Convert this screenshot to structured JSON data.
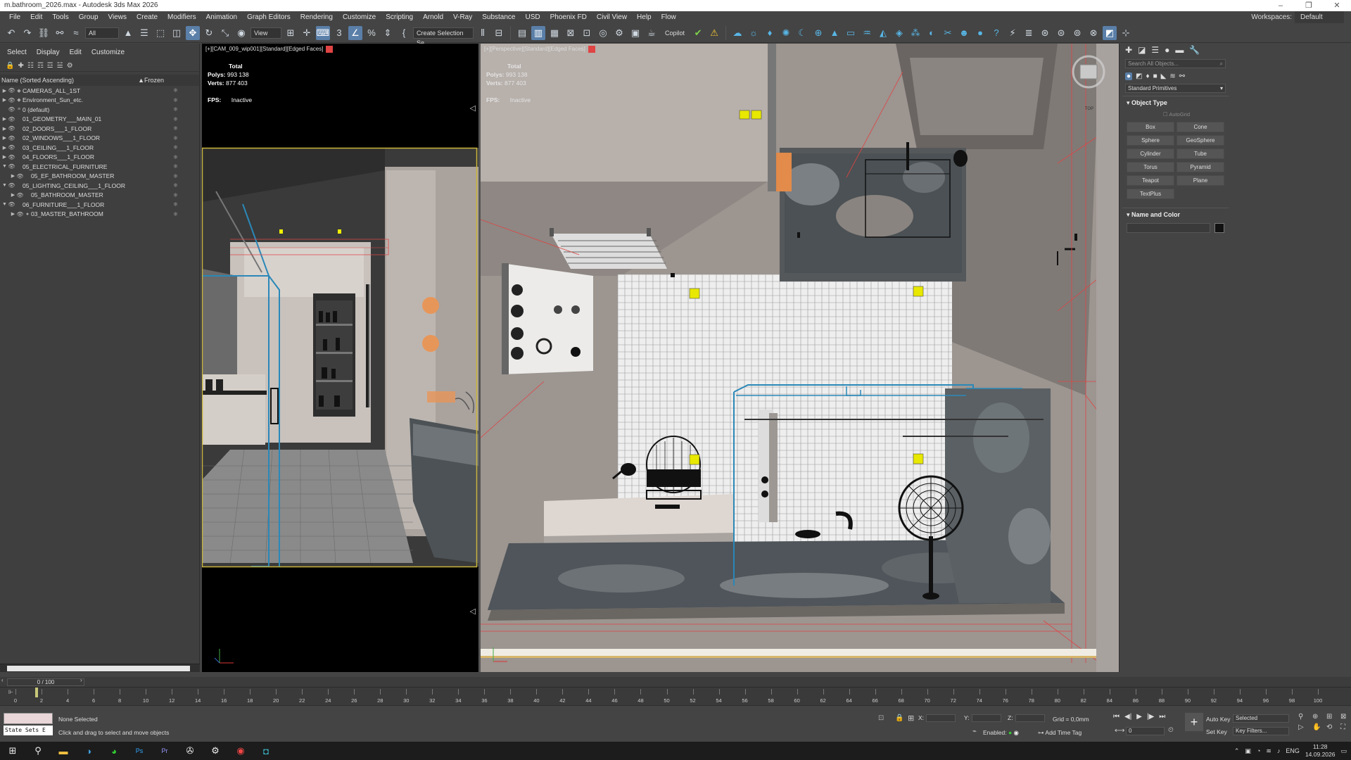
{
  "window": {
    "title": "m.bathroom_2026.max - Autodesk 3ds Max 2026"
  },
  "menu": [
    "File",
    "Edit",
    "Tools",
    "Group",
    "Views",
    "Create",
    "Modifiers",
    "Animation",
    "Graph Editors",
    "Rendering",
    "Customize",
    "Scripting",
    "Arnold",
    "V-Ray",
    "Substance",
    "USD",
    "Phoenix FD",
    "Civil View",
    "Help",
    "Flow"
  ],
  "workspaces": {
    "label": "Workspaces:",
    "value": "Default"
  },
  "toolbar": {
    "filter": "All",
    "refcoord": "View",
    "selection_set": "Create Selection Se",
    "copilot": "Copilot"
  },
  "explorer": {
    "menu": [
      "Select",
      "Display",
      "Edit",
      "Customize"
    ],
    "col_name": "Name (Sorted Ascending)",
    "col_frozen": "▲Frozen",
    "rows": [
      {
        "label": "CAMERAS_ALL_1ST",
        "arrow": "▶",
        "icon": "◆"
      },
      {
        "label": "Environment_Sun_etc.",
        "arrow": "▶",
        "icon": "◆"
      },
      {
        "label": "0 (default)",
        "arrow": "",
        "icon": "≡"
      },
      {
        "label": "01_GEOMETRY___MAIN_01",
        "arrow": "▶",
        "icon": ""
      },
      {
        "label": "02_DOORS___1_FLOOR",
        "arrow": "▶",
        "icon": ""
      },
      {
        "label": "02_WINDOWS___1_FLOOR",
        "arrow": "▶",
        "icon": ""
      },
      {
        "label": "03_CEILING___1_FLOOR",
        "arrow": "▶",
        "icon": ""
      },
      {
        "label": "04_FLOORS___1_FLOOR",
        "arrow": "▶",
        "icon": ""
      },
      {
        "label": "05_ELECTRICAL_FURNITURE",
        "arrow": "▼",
        "icon": ""
      },
      {
        "label": "05_EF_BATHROOM_MASTER",
        "arrow": "▶",
        "icon": "",
        "indent": 1
      },
      {
        "label": "05_LIGHTING_CEILING___1_FLOOR",
        "arrow": "▼",
        "icon": ""
      },
      {
        "label": "05_BATHROOM_MASTER",
        "arrow": "▶",
        "icon": "",
        "indent": 1
      },
      {
        "label": "06_FURNITURE___1_FLOOR",
        "arrow": "▼",
        "icon": ""
      },
      {
        "label": "03_MASTER_BATHROOM",
        "arrow": "▶",
        "icon": "●",
        "indent": 1
      }
    ]
  },
  "viewport_left": {
    "label": "[+][CAM_009_wip001][Standard][Edged Faces]",
    "total": "Total",
    "polys_label": "Polys:",
    "polys": "993 138",
    "verts_label": "Verts:",
    "verts": "877 403",
    "fps_label": "FPS:",
    "fps": "Inactive"
  },
  "viewport_right": {
    "label": "[+][Perspective][Standard][Edged Faces]",
    "total": "Total",
    "polys_label": "Polys:",
    "polys": "993 138",
    "verts_label": "Verts:",
    "verts": "877 403",
    "fps_label": "FPS:",
    "fps": "Inactive",
    "viewcube": "TOP"
  },
  "command_panel": {
    "search_placeholder": "Search All Objects...",
    "category": "Standard Primitives",
    "object_type": "Object Type",
    "autogrid": "AutoGrid",
    "buttons": [
      "Box",
      "Cone",
      "Sphere",
      "GeoSphere",
      "Cylinder",
      "Tube",
      "Torus",
      "Pyramid",
      "Teapot",
      "Plane",
      "TextPlus"
    ],
    "name_color": "Name and Color"
  },
  "timeline": {
    "slider": "0 / 100",
    "ticks": [
      "0",
      "2",
      "4",
      "6",
      "8",
      "10",
      "12",
      "14",
      "16",
      "18",
      "20",
      "22",
      "24",
      "26",
      "28",
      "30",
      "32",
      "34",
      "36",
      "38",
      "40",
      "42",
      "44",
      "46",
      "48",
      "50",
      "52",
      "54",
      "56",
      "58",
      "60",
      "62",
      "64",
      "66",
      "68",
      "70",
      "72",
      "74",
      "76",
      "78",
      "80",
      "82",
      "84",
      "86",
      "88",
      "90",
      "92",
      "94",
      "96",
      "98",
      "100"
    ]
  },
  "status": {
    "state_sets": "State Sets E",
    "selection": "None Selected",
    "prompt": "Click and drag to select and move objects",
    "x_label": "X:",
    "y_label": "Y:",
    "z_label": "Z:",
    "grid": "Grid = 0,0mm",
    "enabled": "Enabled:",
    "add_time_tag": "Add Time Tag",
    "frame": "0",
    "auto_key": "Auto Key",
    "set_key": "Set Key",
    "selected": "Selected",
    "key_filters": "Key Filters..."
  },
  "taskbar": {
    "lang": "ENG",
    "time": "11:28",
    "date": "14.09.2026"
  }
}
